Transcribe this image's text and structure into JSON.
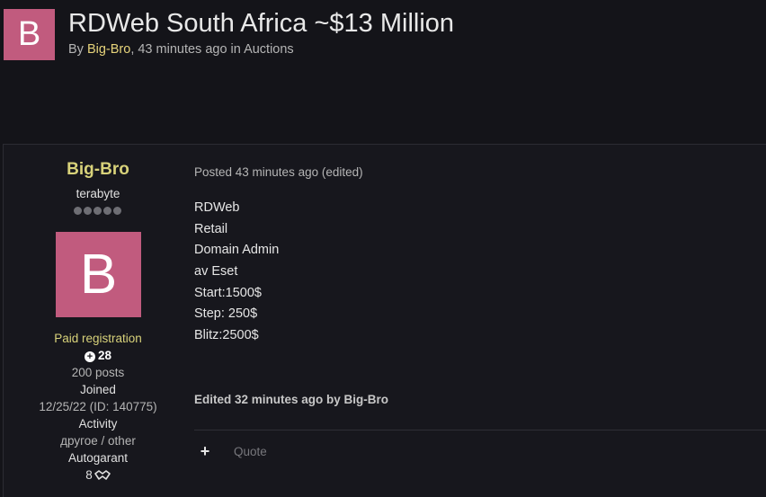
{
  "topic": {
    "avatar_letter": "B",
    "title": "RDWeb South Africa ~$13 Million",
    "meta_by": "By ",
    "meta_author": "Big-Bro",
    "meta_time": ", 43 minutes ago in ",
    "meta_forum": "Auctions"
  },
  "author": {
    "name": "Big-Bro",
    "rank": "terabyte",
    "avatar_letter": "B",
    "group": "Paid registration",
    "reputation": "28",
    "posts": "200 posts",
    "joined_label": "Joined",
    "joined_value": "12/25/22 (ID: 140775)",
    "activity_label": "Activity",
    "activity_value": "другое / other",
    "autogarant_label": "Autogarant",
    "autogarant_value": "8"
  },
  "post": {
    "posted": "Posted 43 minutes ago (edited)",
    "lines": [
      "RDWeb",
      "Retail",
      "Domain Admin",
      "av Eset",
      "Start:1500$",
      "Step: 250$",
      "Blitz:2500$"
    ],
    "edited": "Edited 32 minutes ago by Big-Bro",
    "multiquote_symbol": "+",
    "quote_label": "Quote"
  },
  "colors": {
    "background": "#141419",
    "avatar": "#c15b7e",
    "author_highlight": "#d8d27a"
  }
}
